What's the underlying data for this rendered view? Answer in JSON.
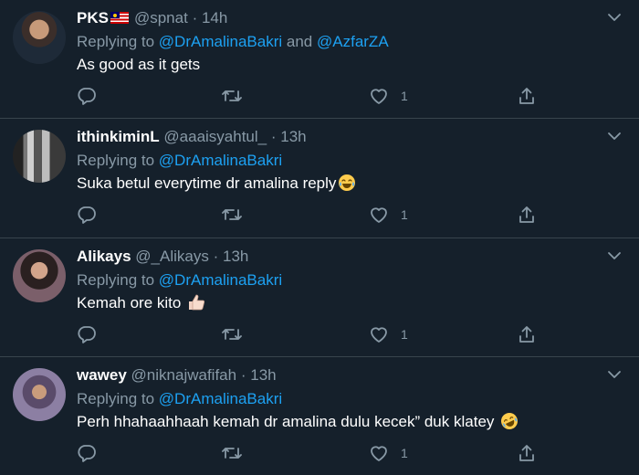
{
  "tweets": [
    {
      "name": "PKS",
      "has_flag": true,
      "handle": "@spnat",
      "time": "14h",
      "replying_prefix": "Replying to",
      "mentions": [
        "@DrAmalinaBakri",
        "@AzfarZA"
      ],
      "mention_joiner": "and",
      "text": "As good as it gets",
      "likes": "1"
    },
    {
      "name": "ithinkiminL",
      "handle": "@aaaisyahtul_",
      "time": "13h",
      "replying_prefix": "Replying to",
      "mentions": [
        "@DrAmalinaBakri"
      ],
      "text": "Suka betul everytime dr amalina reply",
      "emoji": "tears-of-joy-emoji",
      "likes": "1"
    },
    {
      "name": "Alikays",
      "handle": "@_Alikays",
      "time": "13h",
      "replying_prefix": "Replying to",
      "mentions": [
        "@DrAmalinaBakri"
      ],
      "text": "Kemah ore kito",
      "emoji": "thumbs-up-emoji",
      "likes": "1"
    },
    {
      "name": "wawey",
      "handle": "@niknajwafifah",
      "time": "13h",
      "replying_prefix": "Replying to",
      "mentions": [
        "@DrAmalinaBakri"
      ],
      "text": "Perh hhahaahhaah kemah dr amalina dulu kecek” duk klatey",
      "emoji": "rolling-laughing-emoji",
      "likes": "1"
    }
  ],
  "separator": "·",
  "colors": {
    "background": "#15202b",
    "muted": "#8899a6",
    "link": "#1da1f2",
    "divider": "#38444d"
  }
}
